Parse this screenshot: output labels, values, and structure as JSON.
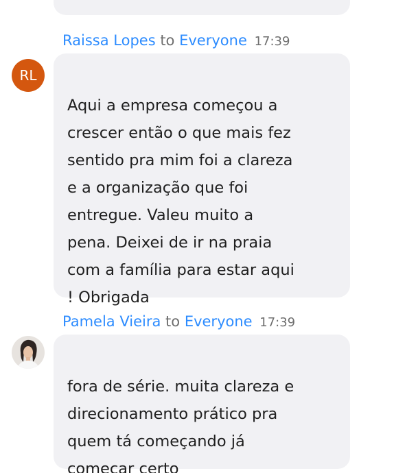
{
  "messages": [
    {
      "sender": "Raissa Lopes",
      "to_word": "to",
      "recipient": "Everyone",
      "time": "17:39",
      "avatar_initials": "RL",
      "avatar_color": "#d4570f",
      "text": "Aqui a empresa começou a\ncrescer então o que mais fez\nsentido pra mim foi a clareza\ne a organização que foi\nentregue. Valeu muito a\npena. Deixei de ir na praia\ncom a família para estar aqui\n! Obrigada"
    },
    {
      "sender": "Pamela Vieira",
      "to_word": "to",
      "recipient": "Everyone",
      "time": "17:39",
      "avatar_icon": "user-photo-icon",
      "text": "fora de série. muita clareza e\ndirecionamento prático pra\nquem tá começando já\ncomeçar certo"
    }
  ],
  "colors": {
    "name_link": "#2d8cff",
    "bubble_bg": "#f1f1f4",
    "meta_gray": "#6e6e6e"
  }
}
